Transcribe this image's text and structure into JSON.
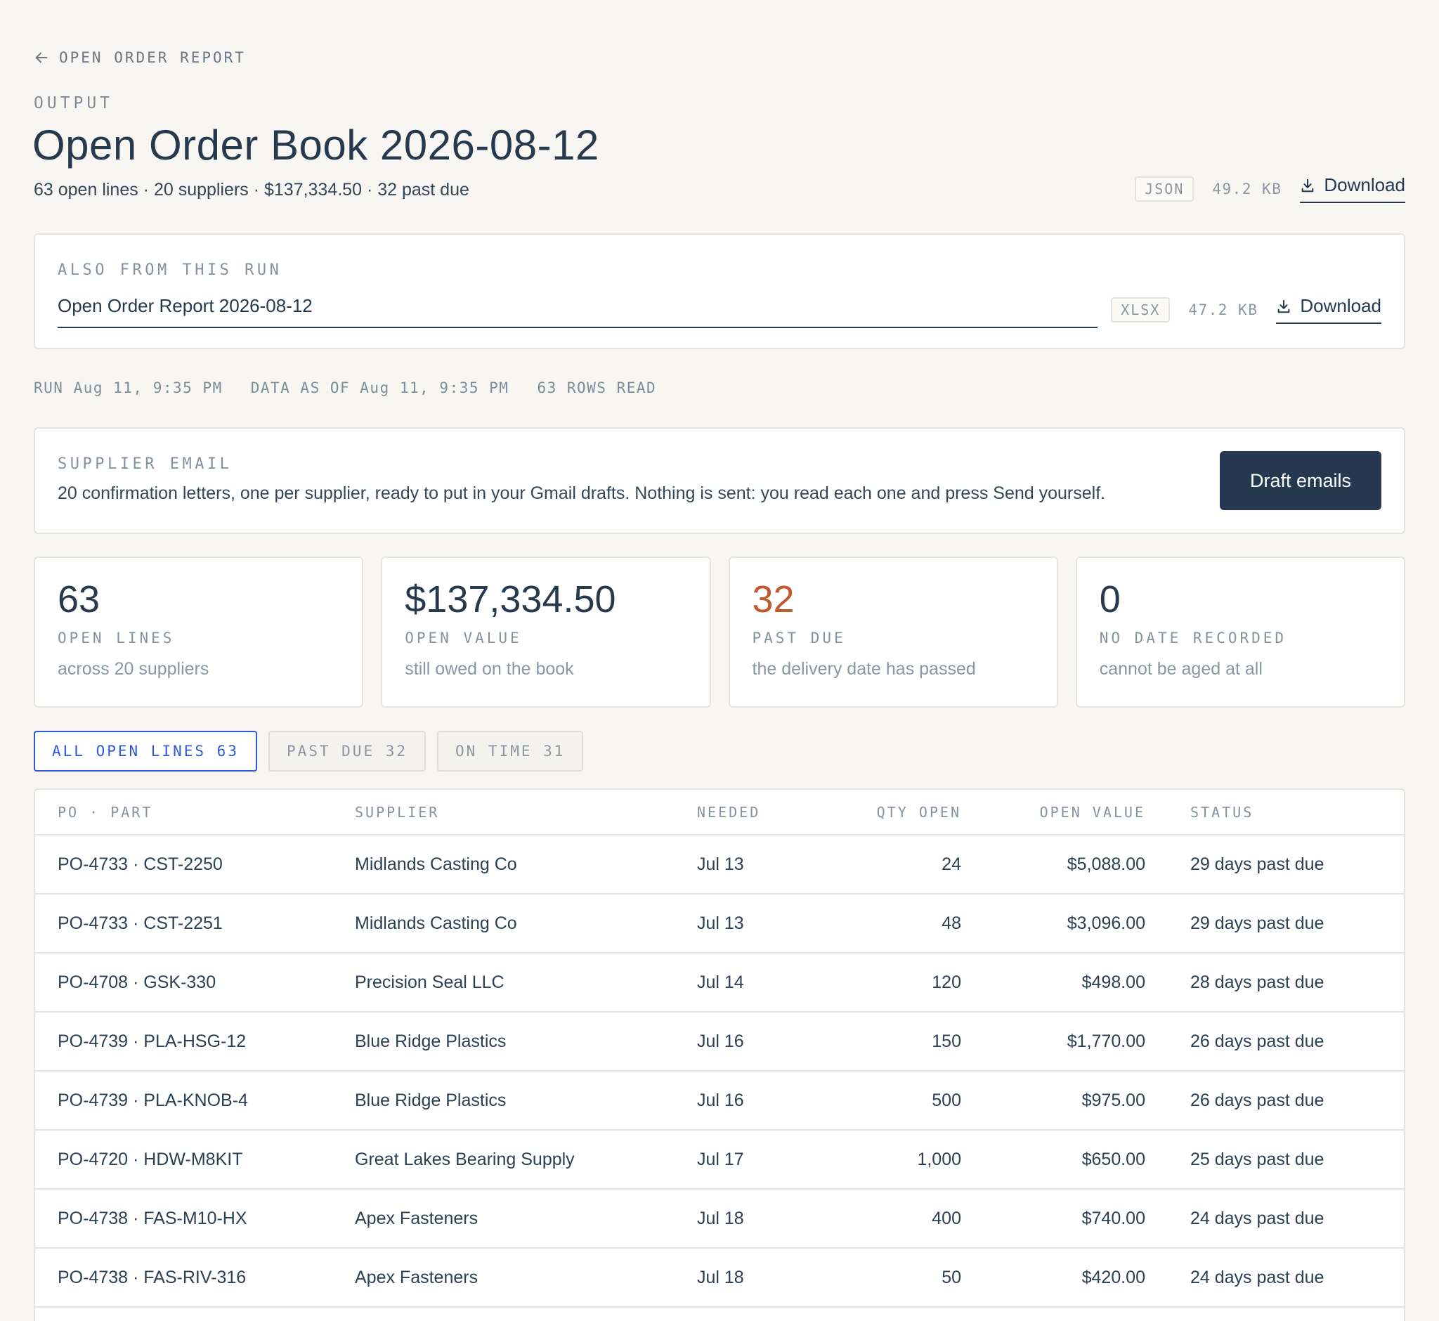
{
  "nav": {
    "back_label": "OPEN ORDER REPORT"
  },
  "header": {
    "eyebrow": "OUTPUT",
    "title": "Open Order Book 2026-08-12",
    "summary": "63 open lines · 20 suppliers · $137,334.50 · 32 past due",
    "file": {
      "format": "JSON",
      "size": "49.2 KB",
      "download_label": "Download"
    }
  },
  "also_from_run": {
    "label": "ALSO FROM THIS RUN",
    "name": "Open Order Report 2026-08-12",
    "format": "XLSX",
    "size": "47.2 KB",
    "download_label": "Download"
  },
  "run_meta": {
    "run": "RUN Aug 11, 9:35 PM",
    "data_as_of": "DATA AS OF Aug 11, 9:35 PM",
    "rows_read": "63 ROWS READ"
  },
  "supplier_email": {
    "label": "SUPPLIER EMAIL",
    "description": "20 confirmation letters, one per supplier, ready to put in your Gmail drafts. Nothing is sent: you read each one and press Send yourself.",
    "button_label": "Draft emails"
  },
  "stats": [
    {
      "value": "63",
      "label": "OPEN LINES",
      "sub": "across 20 suppliers"
    },
    {
      "value": "$137,334.50",
      "label": "OPEN VALUE",
      "sub": "still owed on the book"
    },
    {
      "value": "32",
      "label": "PAST DUE",
      "sub": "the delivery date has passed"
    },
    {
      "value": "0",
      "label": "NO DATE RECORDED",
      "sub": "cannot be aged at all"
    }
  ],
  "colors": {
    "accent": "#2d5bd8",
    "alert": "#c0592b",
    "primary_dark": "#243850",
    "background": "#f7f6f2"
  },
  "filters": [
    {
      "label": "ALL OPEN LINES 63",
      "active": true
    },
    {
      "label": "PAST DUE 32",
      "active": false
    },
    {
      "label": "ON TIME 31",
      "active": false
    }
  ],
  "table": {
    "columns": [
      "PO · PART",
      "SUPPLIER",
      "NEEDED",
      "QTY OPEN",
      "OPEN VALUE",
      "STATUS"
    ],
    "rows": [
      {
        "po_part": "PO-4733 · CST-2250",
        "supplier": "Midlands Casting Co",
        "needed": "Jul 13",
        "qty": "24",
        "value": "$5,088.00",
        "status": "29 days past due"
      },
      {
        "po_part": "PO-4733 · CST-2251",
        "supplier": "Midlands Casting Co",
        "needed": "Jul 13",
        "qty": "48",
        "value": "$3,096.00",
        "status": "29 days past due"
      },
      {
        "po_part": "PO-4708 · GSK-330",
        "supplier": "Precision Seal LLC",
        "needed": "Jul 14",
        "qty": "120",
        "value": "$498.00",
        "status": "28 days past due"
      },
      {
        "po_part": "PO-4739 · PLA-HSG-12",
        "supplier": "Blue Ridge Plastics",
        "needed": "Jul 16",
        "qty": "150",
        "value": "$1,770.00",
        "status": "26 days past due"
      },
      {
        "po_part": "PO-4739 · PLA-KNOB-4",
        "supplier": "Blue Ridge Plastics",
        "needed": "Jul 16",
        "qty": "500",
        "value": "$975.00",
        "status": "26 days past due"
      },
      {
        "po_part": "PO-4720 · HDW-M8KIT",
        "supplier": "Great Lakes Bearing Supply",
        "needed": "Jul 17",
        "qty": "1,000",
        "value": "$650.00",
        "status": "25 days past due"
      },
      {
        "po_part": "PO-4738 · FAS-M10-HX",
        "supplier": "Apex Fasteners",
        "needed": "Jul 18",
        "qty": "400",
        "value": "$740.00",
        "status": "24 days past due"
      },
      {
        "po_part": "PO-4738 · FAS-RIV-316",
        "supplier": "Apex Fasteners",
        "needed": "Jul 18",
        "qty": "50",
        "value": "$420.00",
        "status": "24 days past due"
      }
    ]
  }
}
